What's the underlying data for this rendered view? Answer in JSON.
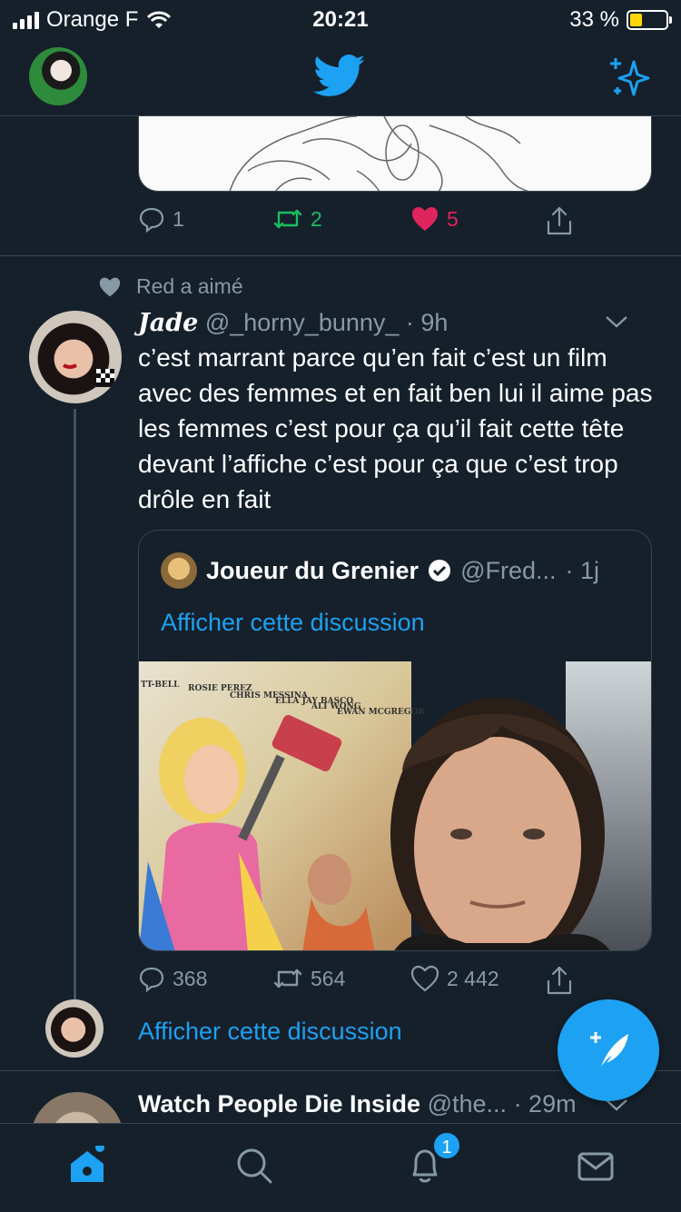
{
  "status_bar": {
    "carrier": "Orange F",
    "time": "20:21",
    "battery": "33 %",
    "battery_level": 0.33
  },
  "colors": {
    "background": "#15202b",
    "accent": "#1da1f2",
    "retweet": "#17bf63",
    "like": "#e0245e",
    "secondary_text": "#8899a6",
    "border": "#38444d"
  },
  "nav": {
    "logo_icon": "twitter-bird-icon",
    "sparkle_icon": "sparkle-icon"
  },
  "prev_tweet": {
    "replies": "1",
    "retweets": "2",
    "likes": "5"
  },
  "liked_by": "Red a aimé",
  "tweet": {
    "name": "Jade",
    "handle": "@_horny_bunny_",
    "time": "· 9h",
    "text": "c’est marrant parce qu’en fait c’est un film avec des femmes et en fait ben lui il aime pas les femmes c’est pour ça qu’il fait cette tête devant l’affiche c’est pour ça que c’est trop drôle en fait",
    "quote": {
      "name": "Joueur du Grenier",
      "handle": "@Fred...",
      "time": "· 1j",
      "link": "Afficher cette discussion",
      "poster_text": [
        "TT-BELL",
        "ROSIE PEREZ",
        "CHRIS MESSINA",
        "ELLA JAY BASCO",
        "ALI WONG",
        "EWAN MCGREGOR"
      ]
    },
    "replies": "368",
    "retweets": "564",
    "likes": "2 442"
  },
  "show_thread": "Afficher cette discussion",
  "next_tweet": {
    "name": "Watch People Die Inside",
    "handle": "@the...",
    "time": "· 29m"
  },
  "tabbar": {
    "notifications_badge": "1"
  }
}
